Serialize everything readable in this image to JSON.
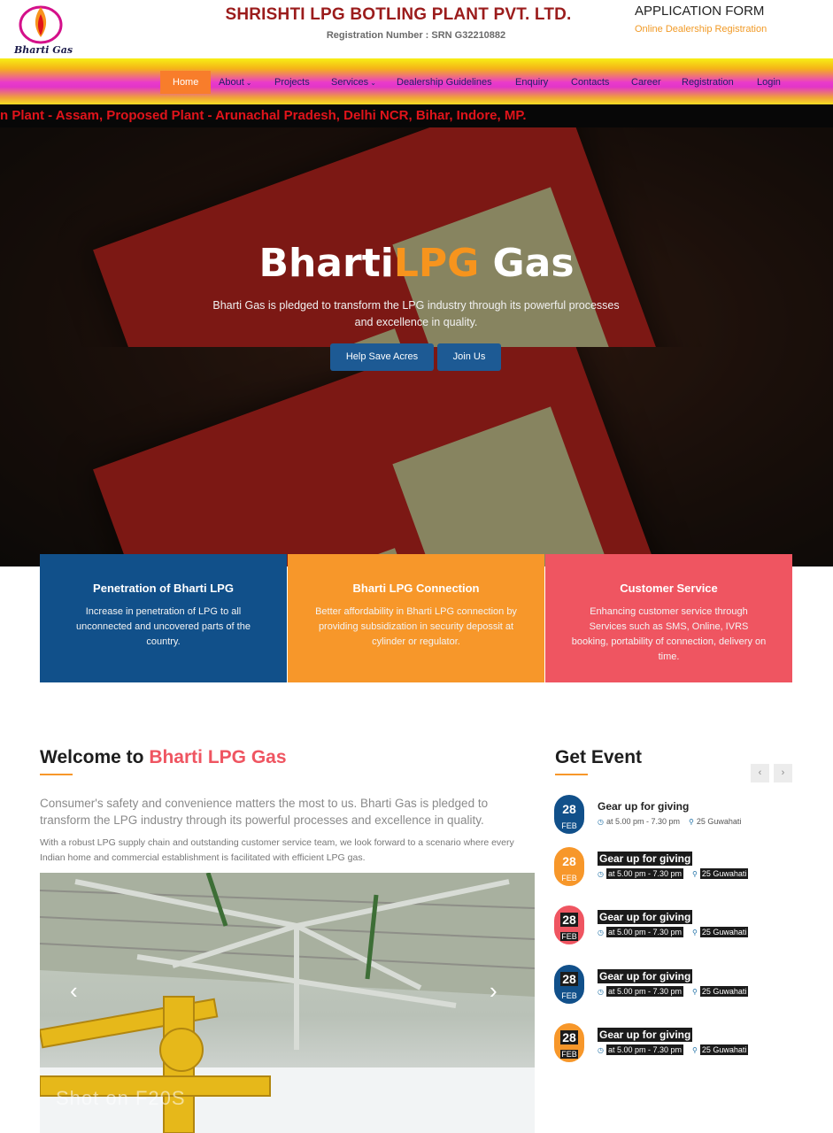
{
  "header": {
    "logo_text": "Bharti Gas",
    "company_name": "SHRISHTI LPG BOTLING PLANT PVT. LTD.",
    "registration": "Registration Number : SRN G32210882",
    "application_form": "APPLICATION FORM",
    "online_registration": "Online Dealership Registration"
  },
  "nav": {
    "items": [
      {
        "label": "Home",
        "active": true
      },
      {
        "label": "About",
        "caret": true
      },
      {
        "label": "Projects"
      },
      {
        "label": "Services",
        "caret": true
      },
      {
        "label": "Dealership Guidelines"
      },
      {
        "label": "Enquiry"
      },
      {
        "label": "Contacts"
      },
      {
        "label": "Career"
      },
      {
        "label": "Registration"
      },
      {
        "label": "Login"
      }
    ],
    "caret_glyph": "⌄"
  },
  "ticker": {
    "text": "n Plant - Assam, Proposed Plant - Arunachal Pradesh, Delhi NCR, Bihar, Indore, MP."
  },
  "hero": {
    "title_part1": "Bharti",
    "title_part2": "LPG",
    "title_part3": " Gas",
    "subtitle": "Bharti Gas is pledged to transform the LPG industry through its powerful processes and excellence in quality.",
    "button1": "Help Save Acres",
    "button2": "Join Us"
  },
  "features": [
    {
      "title": "Penetration of Bharti LPG",
      "text": "Increase in penetration of LPG to all unconnected and uncovered parts of the country."
    },
    {
      "title": "Bharti LPG Connection",
      "text": "Better affordability in Bharti LPG connection by providing subsidization in security depossit at cylinder or regulator."
    },
    {
      "title": "Customer Service",
      "text": "Enhancing customer service through Services such as SMS, Online, IVRS booking, portability of connection, delivery on time."
    }
  ],
  "welcome": {
    "title_prefix": "Welcome to ",
    "title_accent": "Bharti LPG Gas",
    "lead": "Consumer's safety and convenience matters the most to us. Bharti Gas is pledged to transform the LPG industry through its powerful processes and excellence in quality.",
    "body": "With a robust LPG supply chain and outstanding customer service team, we look forward to a scenario where every Indian home and commercial establishment is facilitated with efficient LPG gas.",
    "slider_prev": "‹",
    "slider_next": "›",
    "watermark": "Shot on F20S"
  },
  "events": {
    "title": "Get Event",
    "prev": "‹",
    "next": "›",
    "time_icon": "clock-icon",
    "place_icon": "map-marker-icon",
    "items": [
      {
        "day": "28",
        "month": "FEB",
        "title": "Gear up for giving",
        "time": "at 5.00 pm - 7.30 pm",
        "place": "25 Guwahati",
        "color": "#11508a"
      },
      {
        "day": "28",
        "month": "FEB",
        "title": "Gear up for giving",
        "time": "at 5.00 pm - 7.30 pm",
        "place": "25 Guwahati",
        "color": "#f7972a"
      },
      {
        "day": "28",
        "month": "FEB",
        "title": "Gear up for giving",
        "time": "at 5.00 pm - 7.30 pm",
        "place": "25 Guwahati",
        "color": "#ef5561"
      },
      {
        "day": "28",
        "month": "FEB",
        "title": "Gear up for giving",
        "time": "at 5.00 pm - 7.30 pm",
        "place": "25 Guwahati",
        "color": "#11508a"
      },
      {
        "day": "28",
        "month": "FEB",
        "title": "Gear up for giving",
        "time": "at 5.00 pm - 7.30 pm",
        "place": "25 Guwahati",
        "color": "#f7972a"
      }
    ]
  }
}
